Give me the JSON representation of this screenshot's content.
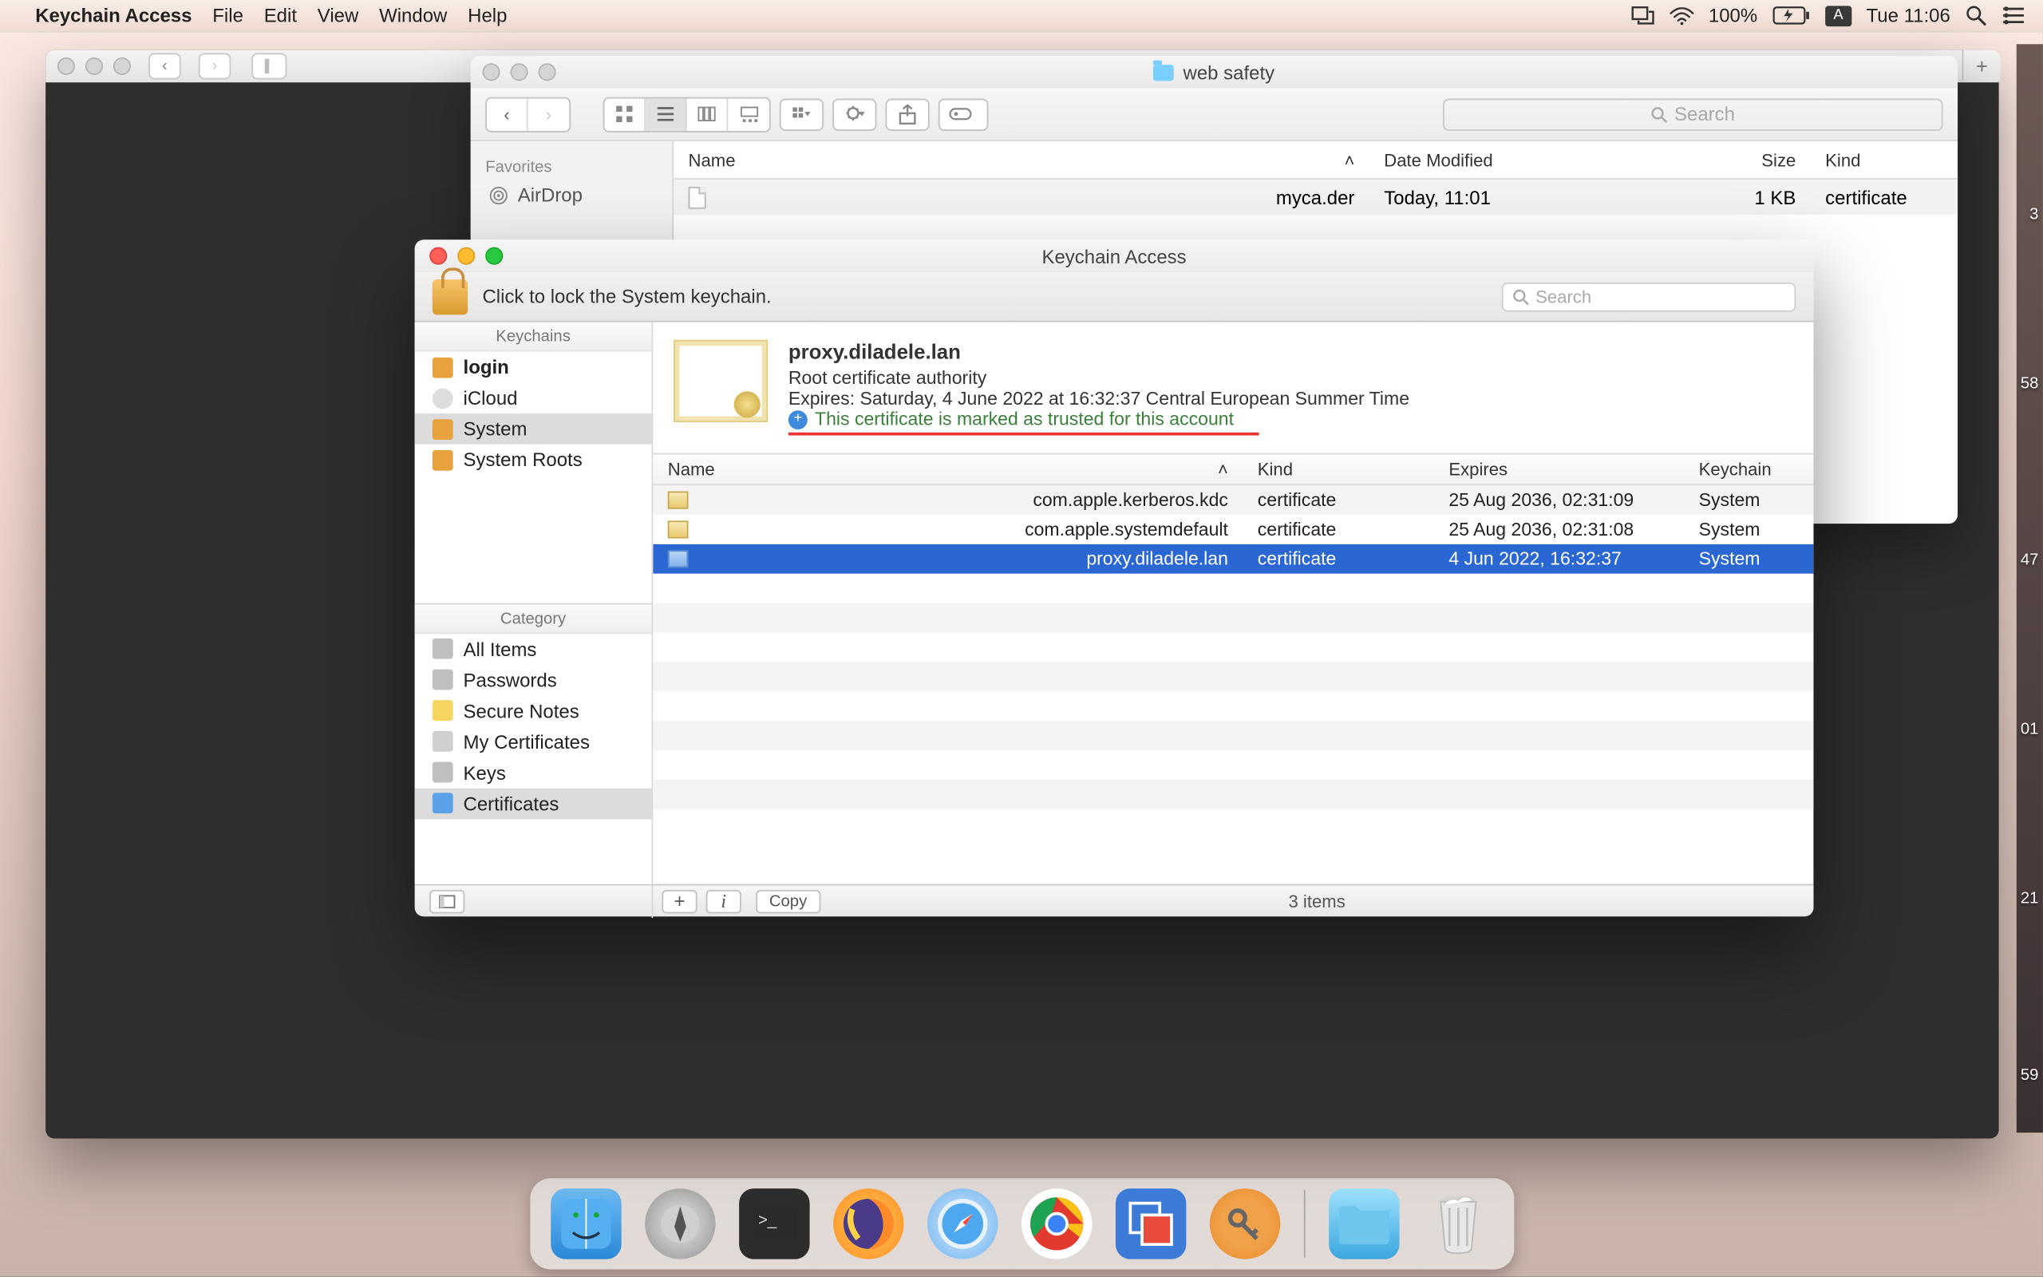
{
  "menubar": {
    "appname": "Keychain Access",
    "items": [
      "File",
      "Edit",
      "View",
      "Window",
      "Help"
    ],
    "battery_pct": "100%",
    "clock": "Tue 11:06",
    "input_badge": "A"
  },
  "darkwin": {
    "newtab": "+"
  },
  "finder": {
    "title": "web safety",
    "search_placeholder": "Search",
    "sidebar": {
      "header": "Favorites",
      "items": [
        "AirDrop"
      ]
    },
    "columns": {
      "name": "Name",
      "date": "Date Modified",
      "size": "Size",
      "kind": "Kind"
    },
    "rows": [
      {
        "name": "myca.der",
        "date": "Today, 11:01",
        "size": "1 KB",
        "kind": "certificate"
      }
    ]
  },
  "keychain": {
    "title": "Keychain Access",
    "lockbar_text": "Click to lock the System keychain.",
    "search_placeholder": "Search",
    "keychains_header": "Keychains",
    "keychains": [
      {
        "label": "login",
        "bold": true
      },
      {
        "label": "iCloud"
      },
      {
        "label": "System",
        "selected": true
      },
      {
        "label": "System Roots"
      }
    ],
    "category_header": "Category",
    "categories": [
      "All Items",
      "Passwords",
      "Secure Notes",
      "My Certificates",
      "Keys",
      "Certificates"
    ],
    "category_selected": 5,
    "cert": {
      "name": "proxy.diladele.lan",
      "authority": "Root certificate authority",
      "expires": "Expires: Saturday, 4 June 2022 at 16:32:37 Central European Summer Time",
      "trust": "This certificate is marked as trusted for this account"
    },
    "table": {
      "columns": {
        "name": "Name",
        "kind": "Kind",
        "expires": "Expires",
        "keychain": "Keychain"
      },
      "rows": [
        {
          "name": "com.apple.kerberos.kdc",
          "kind": "certificate",
          "expires": "25 Aug 2036, 02:31:09",
          "keychain": "System"
        },
        {
          "name": "com.apple.systemdefault",
          "kind": "certificate",
          "expires": "25 Aug 2036, 02:31:08",
          "keychain": "System"
        },
        {
          "name": "proxy.diladele.lan",
          "kind": "certificate",
          "expires": "4 Jun 2022, 16:32:37",
          "keychain": "System",
          "selected": true
        }
      ]
    },
    "footer": {
      "add": "+",
      "info": "i",
      "copy": "Copy",
      "count": "3 items"
    }
  },
  "desk_numbers": [
    "3",
    "58",
    "47",
    "01",
    "21",
    "59"
  ]
}
